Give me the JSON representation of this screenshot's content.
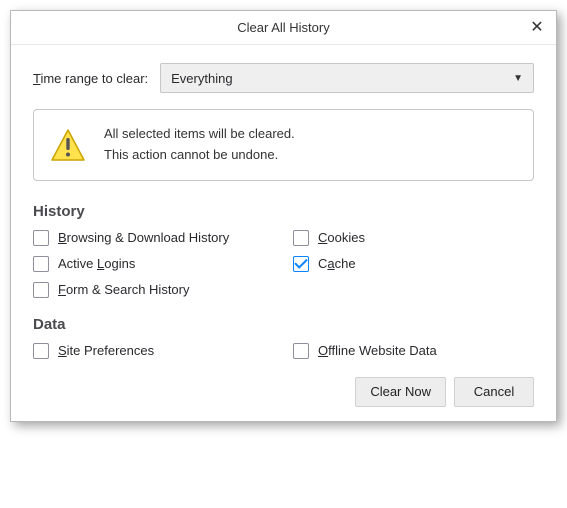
{
  "title": "Clear All History",
  "range": {
    "label_pre": "T",
    "label_rest": "ime range to clear:",
    "selected": "Everything"
  },
  "warning": {
    "line1": "All selected items will be cleared.",
    "line2": "This action cannot be undone."
  },
  "sections": {
    "history": {
      "heading": "History",
      "items": [
        {
          "label": "Browsing & Download History",
          "accesskey_index": 0,
          "checked": false
        },
        {
          "label": "Cookies",
          "accesskey_index": 0,
          "checked": false
        },
        {
          "label": "Active Logins",
          "accesskey_index": 7,
          "checked": false
        },
        {
          "label": "Cache",
          "accesskey_index": 1,
          "checked": true
        },
        {
          "label": "Form & Search History",
          "accesskey_index": 0,
          "checked": false
        }
      ]
    },
    "data": {
      "heading": "Data",
      "items": [
        {
          "label": "Site Preferences",
          "accesskey_index": 0,
          "checked": false
        },
        {
          "label": "Offline Website Data",
          "accesskey_index": 0,
          "checked": false
        }
      ]
    }
  },
  "buttons": {
    "clear": "Clear Now",
    "cancel": "Cancel"
  }
}
